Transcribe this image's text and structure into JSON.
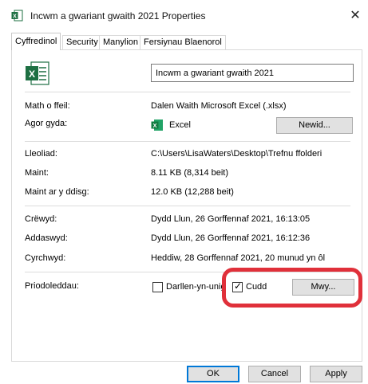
{
  "window": {
    "title": "Incwm a gwariant gwaith 2021 Properties",
    "close_glyph": "✕"
  },
  "tabs": [
    {
      "label": "Cyffredinol",
      "active": true
    },
    {
      "label": "Security",
      "active": false
    },
    {
      "label": "Manylion",
      "active": false
    },
    {
      "label": "Fersiynau Blaenorol",
      "active": false
    }
  ],
  "general": {
    "file_name": "Incwm a gwariant gwaith 2021",
    "type_label": "Math o ffeil:",
    "type_value": "Dalen Waith Microsoft Excel (.xlsx)",
    "opens_with_label": "Agor gyda:",
    "opens_with_value": "Excel",
    "change_button": "Newid...",
    "location_label": "Lleoliad:",
    "location_value": "C:\\Users\\LisaWaters\\Desktop\\Trefnu ffolderi",
    "size_label": "Maint:",
    "size_value": "8.11 KB (8,314 beit)",
    "size_on_disk_label": "Maint ar y ddisg:",
    "size_on_disk_value": "12.0 KB (12,288 beit)",
    "created_label": "Crëwyd:",
    "created_value": "Dydd Llun, 26 Gorffennaf 2021, 16:13:05",
    "modified_label": "Addaswyd:",
    "modified_value": "Dydd Llun, 26 Gorffennaf 2021, 16:12:36",
    "accessed_label": "Cyrchwyd:",
    "accessed_value": "Heddiw, 28 Gorffennaf 2021, 20 munud yn ôl",
    "attributes_label": "Priodoleddau:",
    "readonly_label": "Darllen-yn-unig",
    "readonly_checked": false,
    "hidden_label": "Cudd",
    "hidden_checked": true,
    "hidden_check_glyph": "✓",
    "advanced_button": "Mwy..."
  },
  "footer": {
    "ok": "OK",
    "cancel": "Cancel",
    "apply": "Apply"
  },
  "colors": {
    "excel_green": "#1d6f42",
    "highlight": "#e0303a",
    "default_button_border": "#0078d7"
  },
  "icons": {
    "title": "excel-file-icon",
    "file": "excel-file-icon",
    "opens_with": "excel-app-icon"
  }
}
